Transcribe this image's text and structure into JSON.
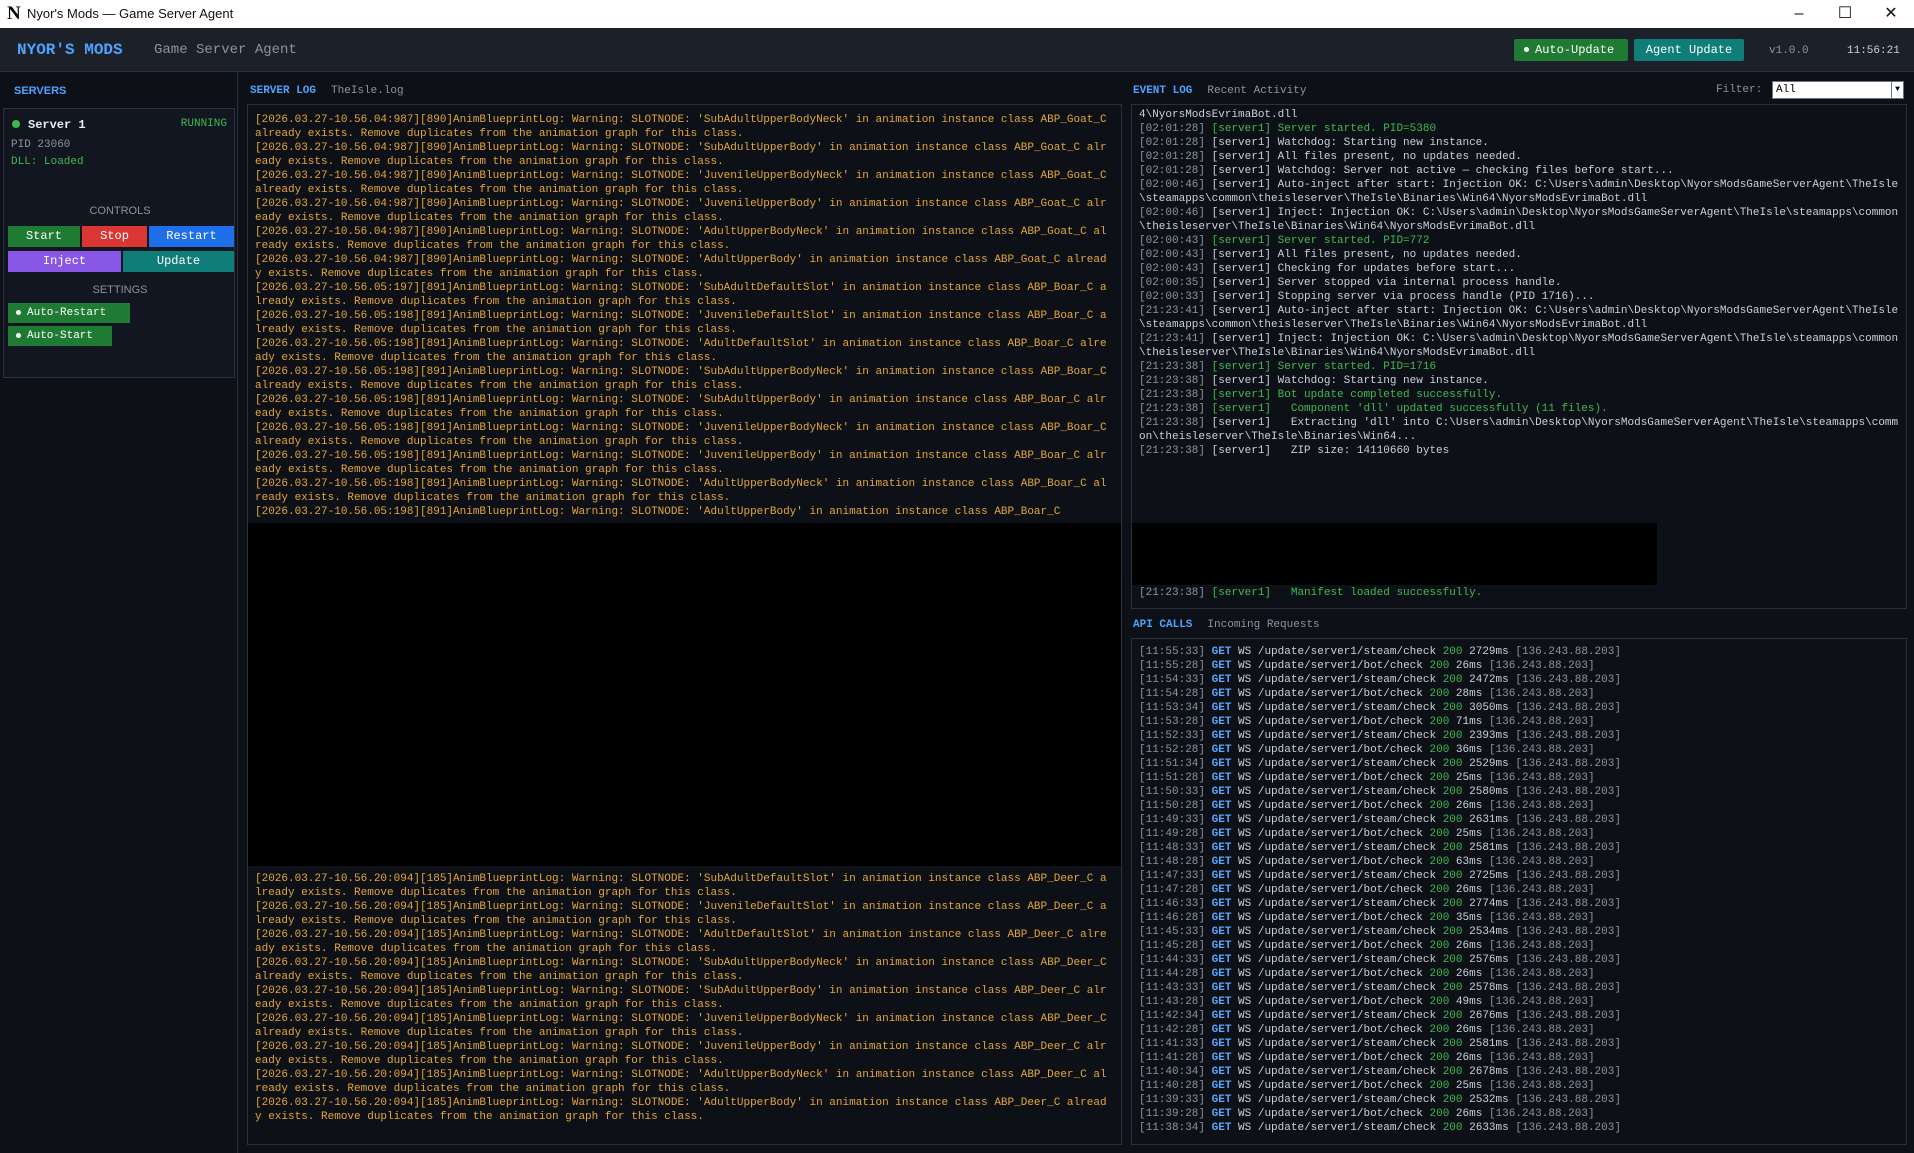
{
  "window": {
    "title": "Nyor's Mods — Game Server Agent",
    "logo_glyph": "N",
    "controls": [
      "–",
      "☐",
      "✕"
    ]
  },
  "header": {
    "brand": "NYOR'S MODS",
    "subtitle": "Game Server Agent",
    "auto_update_label": "Auto-Update",
    "agent_update_label": "Agent Update",
    "version": "v1.0.0",
    "time": "11:56:21"
  },
  "sidebar": {
    "title": "SERVERS",
    "server": {
      "name": "Server 1",
      "status": "RUNNING",
      "pid": "PID 23060",
      "dll": "DLL: Loaded"
    },
    "controls_label": "CONTROLS",
    "buttons": {
      "start": "Start",
      "stop": "Stop",
      "restart": "Restart",
      "inject": "Inject",
      "update": "Update"
    },
    "settings_label": "SETTINGS",
    "toggles": {
      "auto_restart": "Auto-Restart",
      "auto_start": "Auto-Start"
    }
  },
  "server_log": {
    "tab_active": "SERVER LOG",
    "tab_file": "TheIsle.log",
    "lines_top": [
      "[2026.03.27-10.56.04:987][890]AnimBlueprintLog: Warning: SLOTNODE: 'SubAdultUpperBodyNeck' in animation instance class ABP_Goat_C already exists. Remove duplicates from the animation graph for this class.",
      "[2026.03.27-10.56.04:987][890]AnimBlueprintLog: Warning: SLOTNODE: 'SubAdultUpperBody' in animation instance class ABP_Goat_C already exists. Remove duplicates from the animation graph for this class.",
      "[2026.03.27-10.56.04:987][890]AnimBlueprintLog: Warning: SLOTNODE: 'JuvenileUpperBodyNeck' in animation instance class ABP_Goat_C already exists. Remove duplicates from the animation graph for this class.",
      "[2026.03.27-10.56.04:987][890]AnimBlueprintLog: Warning: SLOTNODE: 'JuvenileUpperBody' in animation instance class ABP_Goat_C already exists. Remove duplicates from the animation graph for this class.",
      "[2026.03.27-10.56.04:987][890]AnimBlueprintLog: Warning: SLOTNODE: 'AdultUpperBodyNeck' in animation instance class ABP_Goat_C already exists. Remove duplicates from the animation graph for this class.",
      "[2026.03.27-10.56.04:987][890]AnimBlueprintLog: Warning: SLOTNODE: 'AdultUpperBody' in animation instance class ABP_Goat_C already exists. Remove duplicates from the animation graph for this class.",
      "[2026.03.27-10.56.05:197][891]AnimBlueprintLog: Warning: SLOTNODE: 'SubAdultDefaultSlot' in animation instance class ABP_Boar_C already exists. Remove duplicates from the animation graph for this class.",
      "[2026.03.27-10.56.05:198][891]AnimBlueprintLog: Warning: SLOTNODE: 'JuvenileDefaultSlot' in animation instance class ABP_Boar_C already exists. Remove duplicates from the animation graph for this class.",
      "[2026.03.27-10.56.05:198][891]AnimBlueprintLog: Warning: SLOTNODE: 'AdultDefaultSlot' in animation instance class ABP_Boar_C already exists. Remove duplicates from the animation graph for this class.",
      "[2026.03.27-10.56.05:198][891]AnimBlueprintLog: Warning: SLOTNODE: 'SubAdultUpperBodyNeck' in animation instance class ABP_Boar_C already exists. Remove duplicates from the animation graph for this class.",
      "[2026.03.27-10.56.05:198][891]AnimBlueprintLog: Warning: SLOTNODE: 'SubAdultUpperBody' in animation instance class ABP_Boar_C already exists. Remove duplicates from the animation graph for this class.",
      "[2026.03.27-10.56.05:198][891]AnimBlueprintLog: Warning: SLOTNODE: 'JuvenileUpperBodyNeck' in animation instance class ABP_Boar_C already exists. Remove duplicates from the animation graph for this class.",
      "[2026.03.27-10.56.05:198][891]AnimBlueprintLog: Warning: SLOTNODE: 'JuvenileUpperBody' in animation instance class ABP_Boar_C already exists. Remove duplicates from the animation graph for this class.",
      "[2026.03.27-10.56.05:198][891]AnimBlueprintLog: Warning: SLOTNODE: 'AdultUpperBodyNeck' in animation instance class ABP_Boar_C already exists. Remove duplicates from the animation graph for this class.",
      "[2026.03.27-10.56.05:198][891]AnimBlueprintLog: Warning: SLOTNODE: 'AdultUpperBody' in animation instance class ABP_Boar_C"
    ],
    "lines_bottom": [
      "[2026.03.27-10.56.20:094][185]AnimBlueprintLog: Warning: SLOTNODE: 'SubAdultDefaultSlot' in animation instance class ABP_Deer_C already exists. Remove duplicates from the animation graph for this class.",
      "[2026.03.27-10.56.20:094][185]AnimBlueprintLog: Warning: SLOTNODE: 'JuvenileDefaultSlot' in animation instance class ABP_Deer_C already exists. Remove duplicates from the animation graph for this class.",
      "[2026.03.27-10.56.20:094][185]AnimBlueprintLog: Warning: SLOTNODE: 'AdultDefaultSlot' in animation instance class ABP_Deer_C already exists. Remove duplicates from the animation graph for this class.",
      "[2026.03.27-10.56.20:094][185]AnimBlueprintLog: Warning: SLOTNODE: 'SubAdultUpperBodyNeck' in animation instance class ABP_Deer_C already exists. Remove duplicates from the animation graph for this class.",
      "[2026.03.27-10.56.20:094][185]AnimBlueprintLog: Warning: SLOTNODE: 'SubAdultUpperBody' in animation instance class ABP_Deer_C already exists. Remove duplicates from the animation graph for this class.",
      "[2026.03.27-10.56.20:094][185]AnimBlueprintLog: Warning: SLOTNODE: 'JuvenileUpperBodyNeck' in animation instance class ABP_Deer_C already exists. Remove duplicates from the animation graph for this class.",
      "[2026.03.27-10.56.20:094][185]AnimBlueprintLog: Warning: SLOTNODE: 'JuvenileUpperBody' in animation instance class ABP_Deer_C already exists. Remove duplicates from the animation graph for this class.",
      "[2026.03.27-10.56.20:094][185]AnimBlueprintLog: Warning: SLOTNODE: 'AdultUpperBodyNeck' in animation instance class ABP_Deer_C already exists. Remove duplicates from the animation graph for this class.",
      "[2026.03.27-10.56.20:094][185]AnimBlueprintLog: Warning: SLOTNODE: 'AdultUpperBody' in animation instance class ABP_Deer_C already exists. Remove duplicates from the animation graph for this class."
    ]
  },
  "event_log": {
    "tab_active": "EVENT LOG",
    "tab_sub": "Recent Activity",
    "filter_label": "Filter:",
    "filter_value": "All",
    "entries": [
      {
        "ts": "",
        "text": "4\\NyorsModsEvrimaBot.dll",
        "green": false
      },
      {
        "ts": "[02:01:28]",
        "text": "[server1] Server started. PID=5380",
        "green": true
      },
      {
        "ts": "[02:01:28]",
        "text": "[server1] Watchdog: Starting new instance.",
        "green": false
      },
      {
        "ts": "[02:01:28]",
        "text": "[server1] All files present, no updates needed.",
        "green": false
      },
      {
        "ts": "[02:01:28]",
        "text": "[server1] Watchdog: Server not active — checking files before start...",
        "green": false
      },
      {
        "ts": "[02:00:46]",
        "text": "[server1] Auto-inject after start: Injection OK: C:\\Users\\admin\\Desktop\\NyorsModsGameServerAgent\\TheIsle\\steamapps\\common\\theisleserver\\TheIsle\\Binaries\\Win64\\NyorsModsEvrimaBot.dll",
        "green": false
      },
      {
        "ts": "[02:00:46]",
        "text": "[server1] Inject: Injection OK: C:\\Users\\admin\\Desktop\\NyorsModsGameServerAgent\\TheIsle\\steamapps\\common\\theisleserver\\TheIsle\\Binaries\\Win64\\NyorsModsEvrimaBot.dll",
        "green": false
      },
      {
        "ts": "[02:00:43]",
        "text": "[server1] Server started. PID=772",
        "green": true
      },
      {
        "ts": "[02:00:43]",
        "text": "[server1] All files present, no updates needed.",
        "green": false
      },
      {
        "ts": "[02:00:43]",
        "text": "[server1] Checking for updates before start...",
        "green": false
      },
      {
        "ts": "[02:00:35]",
        "text": "[server1] Server stopped via internal process handle.",
        "green": false
      },
      {
        "ts": "[02:00:33]",
        "text": "[server1] Stopping server via process handle (PID 1716)...",
        "green": false
      },
      {
        "ts": "[21:23:41]",
        "text": "[server1] Auto-inject after start: Injection OK: C:\\Users\\admin\\Desktop\\NyorsModsGameServerAgent\\TheIsle\\steamapps\\common\\theisleserver\\TheIsle\\Binaries\\Win64\\NyorsModsEvrimaBot.dll",
        "green": false
      },
      {
        "ts": "[21:23:41]",
        "text": "[server1] Inject: Injection OK: C:\\Users\\admin\\Desktop\\NyorsModsGameServerAgent\\TheIsle\\steamapps\\common\\theisleserver\\TheIsle\\Binaries\\Win64\\NyorsModsEvrimaBot.dll",
        "green": false
      },
      {
        "ts": "[21:23:38]",
        "text": "[server1] Server started. PID=1716",
        "green": true
      },
      {
        "ts": "[21:23:38]",
        "text": "[server1] Watchdog: Starting new instance.",
        "green": false
      },
      {
        "ts": "[21:23:38]",
        "text": "[server1] Bot update completed successfully.",
        "green": true
      },
      {
        "ts": "[21:23:38]",
        "text": "[server1]   Component 'dll' updated successfully (11 files).",
        "green": true
      },
      {
        "ts": "[21:23:38]",
        "text": "[server1]   Extracting 'dll' into C:\\Users\\admin\\Desktop\\NyorsModsGameServerAgent\\TheIsle\\steamapps\\common\\theisleserver\\TheIsle\\Binaries\\Win64...",
        "green": false
      },
      {
        "ts": "[21:23:38]",
        "text": "[server1]   ZIP size: 14110660 bytes",
        "green": false
      }
    ],
    "entries_after_mask": [
      {
        "ts": "[21:23:38]",
        "text": "[server1]   Manifest loaded successfully.",
        "green": true
      }
    ]
  },
  "api_calls": {
    "tab_active": "API CALLS",
    "tab_sub": "Incoming Requests",
    "rows": [
      {
        "ts": "[11:55:33]",
        "method": "GET",
        "proto": "WS",
        "path": "/update/server1/steam/check",
        "status": "200",
        "dur": "2729ms",
        "ip": "[136.243.88.203]"
      },
      {
        "ts": "[11:55:28]",
        "method": "GET",
        "proto": "WS",
        "path": "/update/server1/bot/check",
        "status": "200",
        "dur": "26ms",
        "ip": "[136.243.88.203]"
      },
      {
        "ts": "[11:54:33]",
        "method": "GET",
        "proto": "WS",
        "path": "/update/server1/steam/check",
        "status": "200",
        "dur": "2472ms",
        "ip": "[136.243.88.203]"
      },
      {
        "ts": "[11:54:28]",
        "method": "GET",
        "proto": "WS",
        "path": "/update/server1/bot/check",
        "status": "200",
        "dur": "28ms",
        "ip": "[136.243.88.203]"
      },
      {
        "ts": "[11:53:34]",
        "method": "GET",
        "proto": "WS",
        "path": "/update/server1/steam/check",
        "status": "200",
        "dur": "3050ms",
        "ip": "[136.243.88.203]"
      },
      {
        "ts": "[11:53:28]",
        "method": "GET",
        "proto": "WS",
        "path": "/update/server1/bot/check",
        "status": "200",
        "dur": "71ms",
        "ip": "[136.243.88.203]"
      },
      {
        "ts": "[11:52:33]",
        "method": "GET",
        "proto": "WS",
        "path": "/update/server1/steam/check",
        "status": "200",
        "dur": "2393ms",
        "ip": "[136.243.88.203]"
      },
      {
        "ts": "[11:52:28]",
        "method": "GET",
        "proto": "WS",
        "path": "/update/server1/bot/check",
        "status": "200",
        "dur": "36ms",
        "ip": "[136.243.88.203]"
      },
      {
        "ts": "[11:51:34]",
        "method": "GET",
        "proto": "WS",
        "path": "/update/server1/steam/check",
        "status": "200",
        "dur": "2529ms",
        "ip": "[136.243.88.203]"
      },
      {
        "ts": "[11:51:28]",
        "method": "GET",
        "proto": "WS",
        "path": "/update/server1/bot/check",
        "status": "200",
        "dur": "25ms",
        "ip": "[136.243.88.203]"
      },
      {
        "ts": "[11:50:33]",
        "method": "GET",
        "proto": "WS",
        "path": "/update/server1/steam/check",
        "status": "200",
        "dur": "2580ms",
        "ip": "[136.243.88.203]"
      },
      {
        "ts": "[11:50:28]",
        "method": "GET",
        "proto": "WS",
        "path": "/update/server1/bot/check",
        "status": "200",
        "dur": "26ms",
        "ip": "[136.243.88.203]"
      },
      {
        "ts": "[11:49:33]",
        "method": "GET",
        "proto": "WS",
        "path": "/update/server1/steam/check",
        "status": "200",
        "dur": "2631ms",
        "ip": "[136.243.88.203]"
      },
      {
        "ts": "[11:49:28]",
        "method": "GET",
        "proto": "WS",
        "path": "/update/server1/bot/check",
        "status": "200",
        "dur": "25ms",
        "ip": "[136.243.88.203]"
      },
      {
        "ts": "[11:48:33]",
        "method": "GET",
        "proto": "WS",
        "path": "/update/server1/steam/check",
        "status": "200",
        "dur": "2581ms",
        "ip": "[136.243.88.203]"
      },
      {
        "ts": "[11:48:28]",
        "method": "GET",
        "proto": "WS",
        "path": "/update/server1/bot/check",
        "status": "200",
        "dur": "63ms",
        "ip": "[136.243.88.203]"
      },
      {
        "ts": "[11:47:33]",
        "method": "GET",
        "proto": "WS",
        "path": "/update/server1/steam/check",
        "status": "200",
        "dur": "2725ms",
        "ip": "[136.243.88.203]"
      },
      {
        "ts": "[11:47:28]",
        "method": "GET",
        "proto": "WS",
        "path": "/update/server1/bot/check",
        "status": "200",
        "dur": "26ms",
        "ip": "[136.243.88.203]"
      },
      {
        "ts": "[11:46:33]",
        "method": "GET",
        "proto": "WS",
        "path": "/update/server1/steam/check",
        "status": "200",
        "dur": "2774ms",
        "ip": "[136.243.88.203]"
      },
      {
        "ts": "[11:46:28]",
        "method": "GET",
        "proto": "WS",
        "path": "/update/server1/bot/check",
        "status": "200",
        "dur": "35ms",
        "ip": "[136.243.88.203]"
      },
      {
        "ts": "[11:45:33]",
        "method": "GET",
        "proto": "WS",
        "path": "/update/server1/steam/check",
        "status": "200",
        "dur": "2534ms",
        "ip": "[136.243.88.203]"
      },
      {
        "ts": "[11:45:28]",
        "method": "GET",
        "proto": "WS",
        "path": "/update/server1/bot/check",
        "status": "200",
        "dur": "26ms",
        "ip": "[136.243.88.203]"
      },
      {
        "ts": "[11:44:33]",
        "method": "GET",
        "proto": "WS",
        "path": "/update/server1/steam/check",
        "status": "200",
        "dur": "2576ms",
        "ip": "[136.243.88.203]"
      },
      {
        "ts": "[11:44:28]",
        "method": "GET",
        "proto": "WS",
        "path": "/update/server1/bot/check",
        "status": "200",
        "dur": "26ms",
        "ip": "[136.243.88.203]"
      },
      {
        "ts": "[11:43:33]",
        "method": "GET",
        "proto": "WS",
        "path": "/update/server1/steam/check",
        "status": "200",
        "dur": "2578ms",
        "ip": "[136.243.88.203]"
      },
      {
        "ts": "[11:43:28]",
        "method": "GET",
        "proto": "WS",
        "path": "/update/server1/bot/check",
        "status": "200",
        "dur": "49ms",
        "ip": "[136.243.88.203]"
      },
      {
        "ts": "[11:42:34]",
        "method": "GET",
        "proto": "WS",
        "path": "/update/server1/steam/check",
        "status": "200",
        "dur": "2676ms",
        "ip": "[136.243.88.203]"
      },
      {
        "ts": "[11:42:28]",
        "method": "GET",
        "proto": "WS",
        "path": "/update/server1/bot/check",
        "status": "200",
        "dur": "26ms",
        "ip": "[136.243.88.203]"
      },
      {
        "ts": "[11:41:33]",
        "method": "GET",
        "proto": "WS",
        "path": "/update/server1/steam/check",
        "status": "200",
        "dur": "2581ms",
        "ip": "[136.243.88.203]"
      },
      {
        "ts": "[11:41:28]",
        "method": "GET",
        "proto": "WS",
        "path": "/update/server1/bot/check",
        "status": "200",
        "dur": "26ms",
        "ip": "[136.243.88.203]"
      },
      {
        "ts": "[11:40:34]",
        "method": "GET",
        "proto": "WS",
        "path": "/update/server1/steam/check",
        "status": "200",
        "dur": "2678ms",
        "ip": "[136.243.88.203]"
      },
      {
        "ts": "[11:40:28]",
        "method": "GET",
        "proto": "WS",
        "path": "/update/server1/bot/check",
        "status": "200",
        "dur": "25ms",
        "ip": "[136.243.88.203]"
      },
      {
        "ts": "[11:39:33]",
        "method": "GET",
        "proto": "WS",
        "path": "/update/server1/steam/check",
        "status": "200",
        "dur": "2532ms",
        "ip": "[136.243.88.203]"
      },
      {
        "ts": "[11:39:28]",
        "method": "GET",
        "proto": "WS",
        "path": "/update/server1/bot/check",
        "status": "200",
        "dur": "26ms",
        "ip": "[136.243.88.203]"
      },
      {
        "ts": "[11:38:34]",
        "method": "GET",
        "proto": "WS",
        "path": "/update/server1/steam/check",
        "status": "200",
        "dur": "2633ms",
        "ip": "[136.243.88.203]"
      }
    ]
  },
  "colors": {
    "accent": "#4da3ff",
    "log_warning": "#e3a63a",
    "success": "#3fb950",
    "start": "#1f7a33",
    "stop": "#da3633",
    "restart": "#1f6feb",
    "inject": "#8957e5",
    "update": "#0f7d78"
  }
}
